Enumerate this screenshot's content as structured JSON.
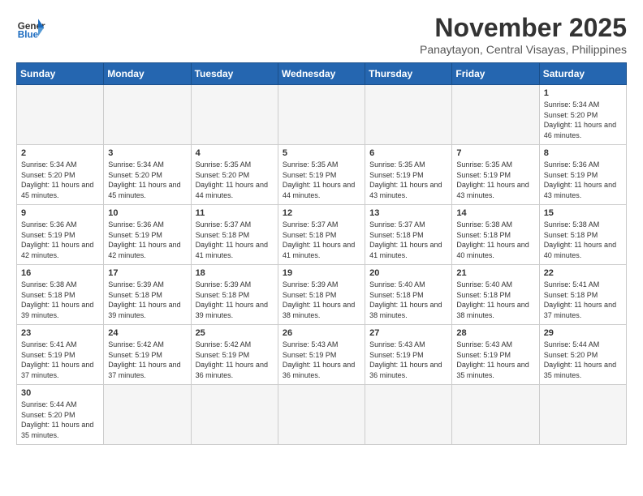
{
  "header": {
    "logo_general": "General",
    "logo_blue": "Blue",
    "month": "November 2025",
    "location": "Panaytayon, Central Visayas, Philippines"
  },
  "days_of_week": [
    "Sunday",
    "Monday",
    "Tuesday",
    "Wednesday",
    "Thursday",
    "Friday",
    "Saturday"
  ],
  "weeks": [
    [
      {
        "num": "",
        "info": ""
      },
      {
        "num": "",
        "info": ""
      },
      {
        "num": "",
        "info": ""
      },
      {
        "num": "",
        "info": ""
      },
      {
        "num": "",
        "info": ""
      },
      {
        "num": "",
        "info": ""
      },
      {
        "num": "1",
        "info": "Sunrise: 5:34 AM\nSunset: 5:20 PM\nDaylight: 11 hours and 46 minutes."
      }
    ],
    [
      {
        "num": "2",
        "info": "Sunrise: 5:34 AM\nSunset: 5:20 PM\nDaylight: 11 hours and 45 minutes."
      },
      {
        "num": "3",
        "info": "Sunrise: 5:34 AM\nSunset: 5:20 PM\nDaylight: 11 hours and 45 minutes."
      },
      {
        "num": "4",
        "info": "Sunrise: 5:35 AM\nSunset: 5:20 PM\nDaylight: 11 hours and 44 minutes."
      },
      {
        "num": "5",
        "info": "Sunrise: 5:35 AM\nSunset: 5:19 PM\nDaylight: 11 hours and 44 minutes."
      },
      {
        "num": "6",
        "info": "Sunrise: 5:35 AM\nSunset: 5:19 PM\nDaylight: 11 hours and 43 minutes."
      },
      {
        "num": "7",
        "info": "Sunrise: 5:35 AM\nSunset: 5:19 PM\nDaylight: 11 hours and 43 minutes."
      },
      {
        "num": "8",
        "info": "Sunrise: 5:36 AM\nSunset: 5:19 PM\nDaylight: 11 hours and 43 minutes."
      }
    ],
    [
      {
        "num": "9",
        "info": "Sunrise: 5:36 AM\nSunset: 5:19 PM\nDaylight: 11 hours and 42 minutes."
      },
      {
        "num": "10",
        "info": "Sunrise: 5:36 AM\nSunset: 5:19 PM\nDaylight: 11 hours and 42 minutes."
      },
      {
        "num": "11",
        "info": "Sunrise: 5:37 AM\nSunset: 5:18 PM\nDaylight: 11 hours and 41 minutes."
      },
      {
        "num": "12",
        "info": "Sunrise: 5:37 AM\nSunset: 5:18 PM\nDaylight: 11 hours and 41 minutes."
      },
      {
        "num": "13",
        "info": "Sunrise: 5:37 AM\nSunset: 5:18 PM\nDaylight: 11 hours and 41 minutes."
      },
      {
        "num": "14",
        "info": "Sunrise: 5:38 AM\nSunset: 5:18 PM\nDaylight: 11 hours and 40 minutes."
      },
      {
        "num": "15",
        "info": "Sunrise: 5:38 AM\nSunset: 5:18 PM\nDaylight: 11 hours and 40 minutes."
      }
    ],
    [
      {
        "num": "16",
        "info": "Sunrise: 5:38 AM\nSunset: 5:18 PM\nDaylight: 11 hours and 39 minutes."
      },
      {
        "num": "17",
        "info": "Sunrise: 5:39 AM\nSunset: 5:18 PM\nDaylight: 11 hours and 39 minutes."
      },
      {
        "num": "18",
        "info": "Sunrise: 5:39 AM\nSunset: 5:18 PM\nDaylight: 11 hours and 39 minutes."
      },
      {
        "num": "19",
        "info": "Sunrise: 5:39 AM\nSunset: 5:18 PM\nDaylight: 11 hours and 38 minutes."
      },
      {
        "num": "20",
        "info": "Sunrise: 5:40 AM\nSunset: 5:18 PM\nDaylight: 11 hours and 38 minutes."
      },
      {
        "num": "21",
        "info": "Sunrise: 5:40 AM\nSunset: 5:18 PM\nDaylight: 11 hours and 38 minutes."
      },
      {
        "num": "22",
        "info": "Sunrise: 5:41 AM\nSunset: 5:18 PM\nDaylight: 11 hours and 37 minutes."
      }
    ],
    [
      {
        "num": "23",
        "info": "Sunrise: 5:41 AM\nSunset: 5:19 PM\nDaylight: 11 hours and 37 minutes."
      },
      {
        "num": "24",
        "info": "Sunrise: 5:42 AM\nSunset: 5:19 PM\nDaylight: 11 hours and 37 minutes."
      },
      {
        "num": "25",
        "info": "Sunrise: 5:42 AM\nSunset: 5:19 PM\nDaylight: 11 hours and 36 minutes."
      },
      {
        "num": "26",
        "info": "Sunrise: 5:43 AM\nSunset: 5:19 PM\nDaylight: 11 hours and 36 minutes."
      },
      {
        "num": "27",
        "info": "Sunrise: 5:43 AM\nSunset: 5:19 PM\nDaylight: 11 hours and 36 minutes."
      },
      {
        "num": "28",
        "info": "Sunrise: 5:43 AM\nSunset: 5:19 PM\nDaylight: 11 hours and 35 minutes."
      },
      {
        "num": "29",
        "info": "Sunrise: 5:44 AM\nSunset: 5:20 PM\nDaylight: 11 hours and 35 minutes."
      }
    ],
    [
      {
        "num": "30",
        "info": "Sunrise: 5:44 AM\nSunset: 5:20 PM\nDaylight: 11 hours and 35 minutes."
      },
      {
        "num": "",
        "info": ""
      },
      {
        "num": "",
        "info": ""
      },
      {
        "num": "",
        "info": ""
      },
      {
        "num": "",
        "info": ""
      },
      {
        "num": "",
        "info": ""
      },
      {
        "num": "",
        "info": ""
      }
    ]
  ]
}
